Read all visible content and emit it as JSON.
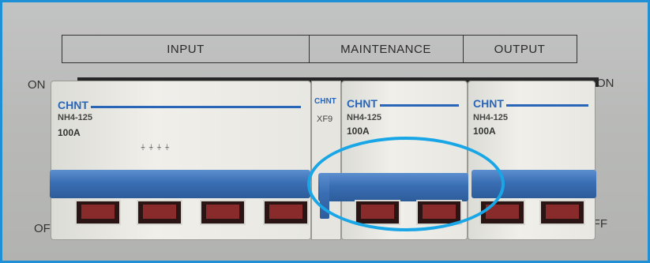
{
  "labels": {
    "input": "INPUT",
    "maintenance": "MAINTENANCE",
    "output": "OUTPUT"
  },
  "sides": {
    "on_left": "ON",
    "on_right": "ON",
    "off_left": "OFF",
    "off_right": "OFF"
  },
  "breakers": [
    {
      "brand": "CHNT",
      "model": "NH4-125",
      "rating": "100A"
    },
    {
      "brand": "CHNT",
      "model": "NH4-125",
      "rating": "100A"
    },
    {
      "brand": "CHNT",
      "model": "NH4-125",
      "rating": "100A"
    }
  ],
  "aux": {
    "brand": "CHNT",
    "model": "XF9"
  },
  "colors": {
    "frame": "#1f8fd6",
    "handle": "#3a6eb4",
    "highlight": "#19a6e6"
  }
}
